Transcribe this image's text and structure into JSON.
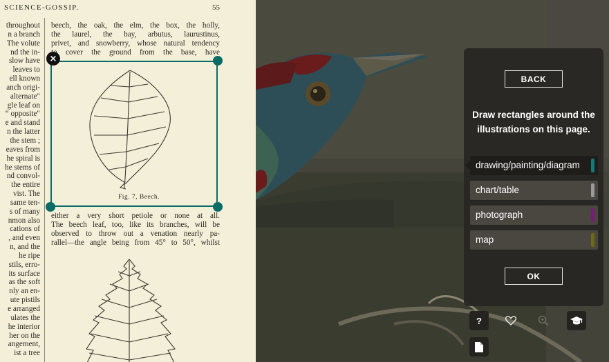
{
  "page": {
    "running_head": "SCIENCE-GOSSIP.",
    "page_number": "55",
    "left_column_lines": [
      "throughout",
      "n a branch",
      "The volute",
      "nd the in-",
      "slow have",
      "leaves to",
      "ell known",
      "anch origi-",
      "alternate\"",
      "gle leaf on",
      "“ opposite\"",
      "e and stand",
      "n the latter",
      "the stem ;",
      "eaves from",
      "he spiral is",
      "he stems of",
      "nd convol-",
      "the entire",
      "vist.  The",
      "same ten-",
      "s of many",
      "nmon also",
      "cations of",
      ", and even",
      "n, and the",
      "he ripe",
      "stils, erro-",
      "its surface",
      "as the soft",
      "nly an en-",
      "ute pistils",
      "e arranged",
      "ulates the",
      "he interior",
      "her on the",
      "angement,",
      "ist a tree"
    ],
    "right_column_top": [
      "beech, the oak, the elm, the box, the holly,",
      "the laurel, the bay, arbutus, laurustinus,",
      "privet, and snowberry, whose natural tendency",
      "to cover the ground from the base, have"
    ],
    "figure_caption": "Fig. 7, Beech.",
    "right_column_bottom": [
      "either a very short petiole or none at all.",
      "The beech leaf, too, like its branches, will be",
      "observed to throw out a venation nearly pa-",
      "rallel—the angle being from 45° to 50°, whilst"
    ]
  },
  "selection": {
    "delete_icon": "close-icon",
    "delete_glyph": "×",
    "color": "#0b6b66"
  },
  "panel": {
    "back_label": "BACK",
    "instructions": "Draw rectangles around the illustrations on this page.",
    "options": [
      {
        "label": "drawing/painting/diagram",
        "color": "#0f7b7b",
        "selected": true
      },
      {
        "label": "chart/table",
        "color": "#9a9a9a",
        "selected": false
      },
      {
        "label": "photograph",
        "color": "#7a1a7a",
        "selected": false
      },
      {
        "label": "map",
        "color": "#6b6a10",
        "selected": false
      }
    ],
    "ok_label": "OK"
  },
  "tools": {
    "help_label": "?",
    "icons": [
      "help-icon",
      "heart-icon",
      "zoom-icon",
      "graduation-cap-icon",
      "document-icon"
    ]
  }
}
